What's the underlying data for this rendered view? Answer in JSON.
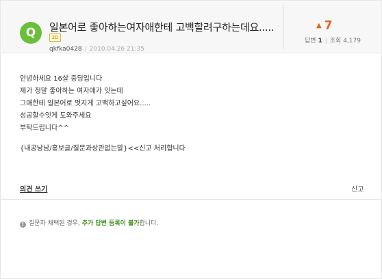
{
  "question": {
    "badge": "Q",
    "title": "일본어로 좋아하는여자애한테 고백할려구하는데요.....",
    "level_tag": "2D",
    "author": "qkfka0428",
    "date": "2010.04.26 21:35"
  },
  "stats": {
    "score": "7",
    "answers_label": "답변",
    "answers_count": "1",
    "views_label": "조회",
    "views_count": "4,179"
  },
  "body": {
    "lines": [
      "안녕하세요  16살 중딩입니다",
      "제가 정말 좋아하는 여자애가 잇는데",
      "그애한테 일본어로 멋지게 고백하고싶어요.....",
      "성공할수잇게 도와주세요",
      "부탁드립니다^^"
    ],
    "note": "{내공낭남/홍보글/질문과상관없는말}<<신고 처리합니다"
  },
  "actions": {
    "opinion_label": "의견 쓰기",
    "report_label": "신고"
  },
  "notice": {
    "prefix": "질문자 채택된 경우, ",
    "highlight": "추가 답변 등록이 불가",
    "suffix": "합니다."
  },
  "colors": {
    "accent_green": "#6cbf3b",
    "score_orange": "#e0661a"
  }
}
